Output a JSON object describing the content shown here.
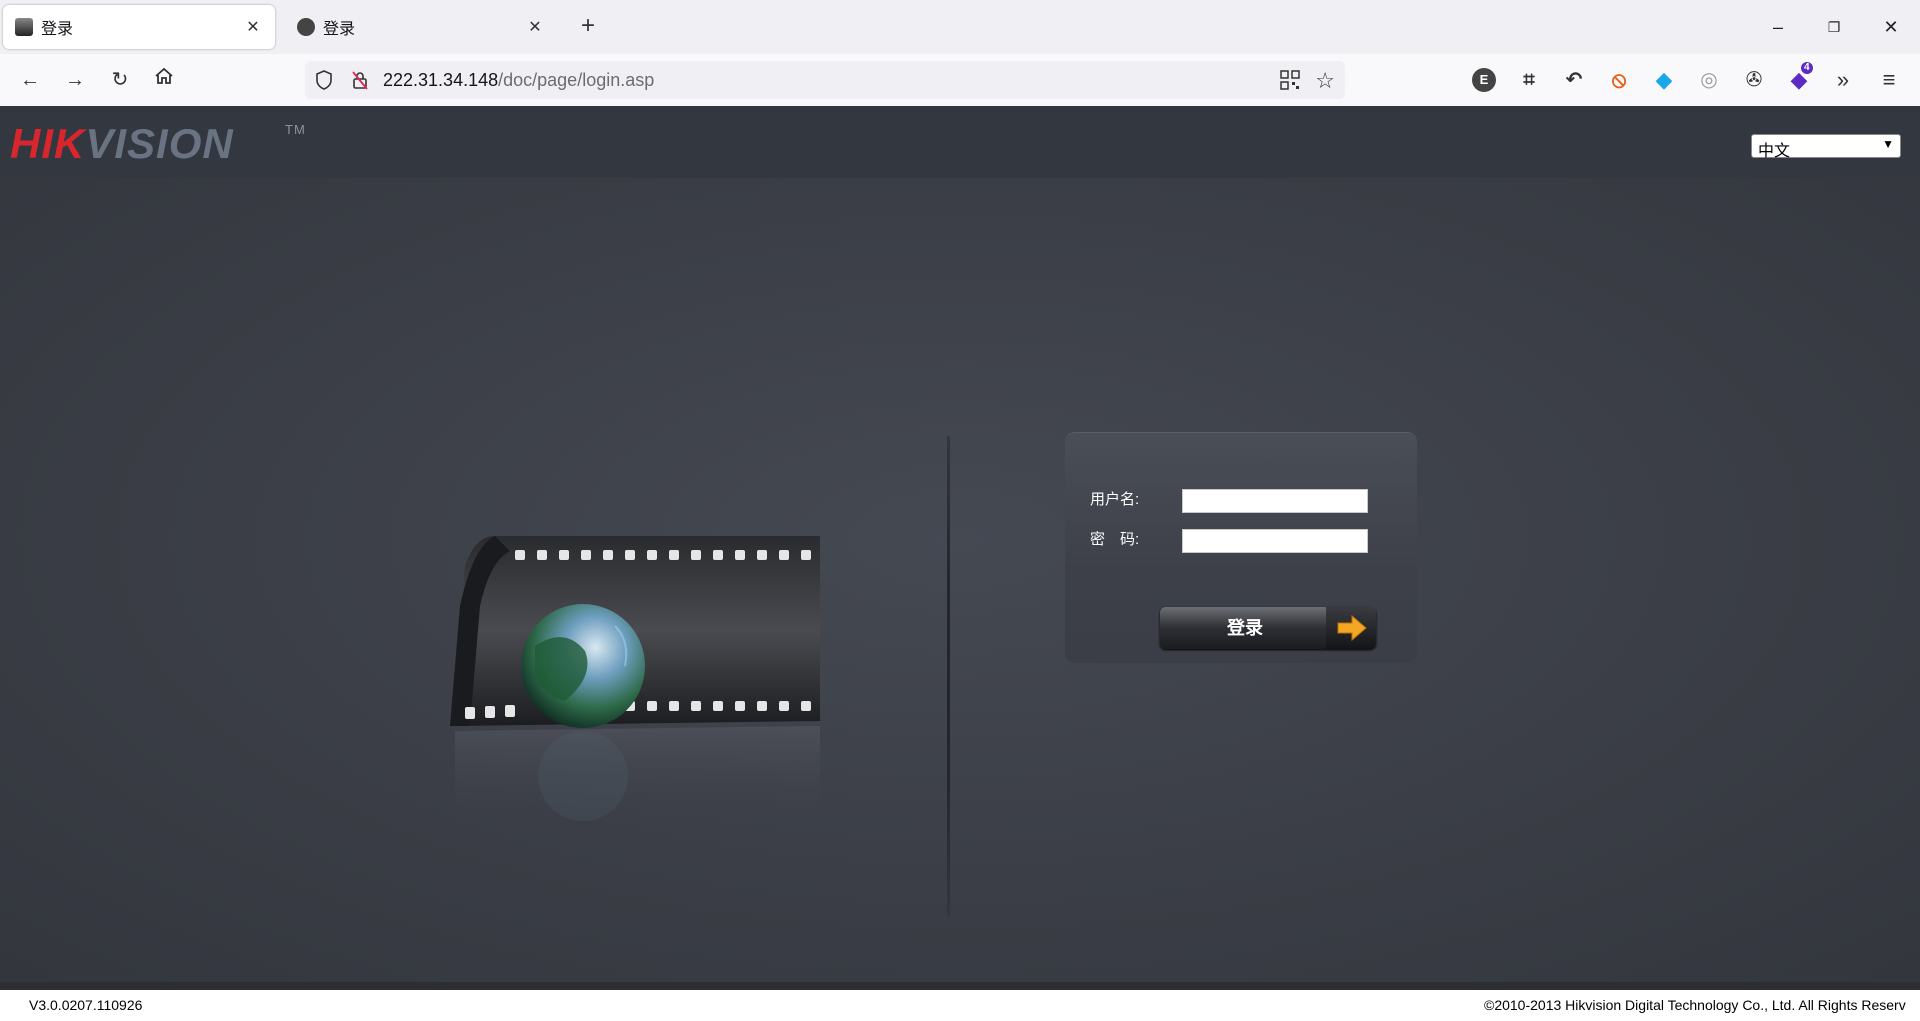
{
  "browser": {
    "tabs": [
      {
        "title": "登录",
        "active": true
      },
      {
        "title": "登录",
        "active": false
      }
    ],
    "url_host": "222.31.34.148",
    "url_path": "/doc/page/login.asp",
    "extensions": [
      {
        "name": "e-extension-icon",
        "glyph": "E",
        "color": "#444"
      },
      {
        "name": "crop-icon",
        "glyph": "⌗",
        "color": "#333"
      },
      {
        "name": "undo-icon",
        "glyph": "↶",
        "color": "#333"
      },
      {
        "name": "blocker-extension-icon",
        "glyph": "⦸",
        "color": "#e5621c"
      },
      {
        "name": "cube-extension-icon",
        "glyph": "◆",
        "color": "#1aa7e8"
      },
      {
        "name": "gray-extension-icon",
        "glyph": "◎",
        "color": "#999"
      },
      {
        "name": "cookie-icon",
        "glyph": "✇",
        "color": "#333"
      },
      {
        "name": "badge-extension-icon",
        "glyph": "◆",
        "color": "#5b2bc4",
        "badge": "4"
      }
    ]
  },
  "page": {
    "logo_hik": "HIK",
    "logo_vision": "VISION",
    "logo_tm": "TM",
    "language": "中文",
    "username_label": "用户名:",
    "password_label": "密　码:",
    "username_value": "",
    "password_value": "",
    "login_button": "登录",
    "version": "V3.0.0207.110926",
    "copyright": "©2010-2013 Hikvision Digital Technology Co., Ltd. All Rights Reserv"
  }
}
